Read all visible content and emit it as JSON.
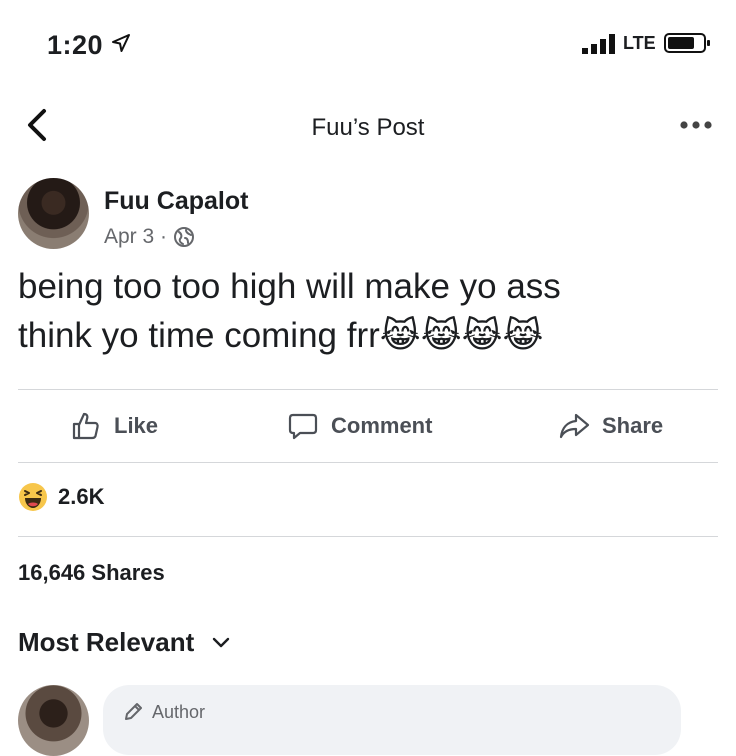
{
  "status_bar": {
    "time": "1:20",
    "network": "LTE",
    "icons": [
      "location-arrow-icon",
      "signal-bars-icon",
      "battery-icon"
    ]
  },
  "nav": {
    "title": "Fuu’s Post",
    "icons": [
      "back-chevron-icon",
      "more-dots-icon"
    ]
  },
  "post": {
    "author": "Fuu Capalot",
    "date": "Apr 3 ·",
    "line1": "being too too high will make yo ass",
    "line2": "think yo time coming frr",
    "emojis": [
      "😹",
      "😹",
      "😹",
      "😹"
    ]
  },
  "actions": {
    "like": "Like",
    "comment": "Comment",
    "share": "Share"
  },
  "reactions": {
    "count": "2.6K",
    "icon": "haha-reaction-icon"
  },
  "shares": "16,646 Shares",
  "comments": {
    "sort": "Most Relevant",
    "first_badge": "Author"
  },
  "colors": {
    "text": "#1c1e21",
    "secondary": "#65676b",
    "divider": "#d5d7da",
    "bubble": "#f0f2f5",
    "haha_yellow": "#f7c64b"
  }
}
